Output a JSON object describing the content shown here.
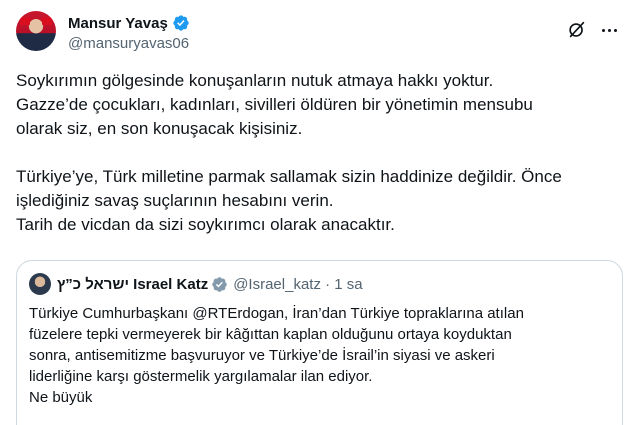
{
  "author": {
    "display_name": "Mansur Yavaş",
    "handle": "@mansuryavas06"
  },
  "tweet": {
    "lines": [
      "Soykırımın gölgesinde konuşanların nutuk atmaya hakkı yoktur.",
      "Gazze’de çocukları, kadınları, sivilleri öldüren bir yönetimin mensubu",
      "olarak siz, en son konuşacak kişisiniz.",
      "Türkiye’ye, Türk milletine parmak sallamak sizin haddinize değildir. Önce",
      "işlediğiniz savaş suçlarının hesabını verin.",
      "Tarih de vicdan da sizi soykırımcı olarak anacaktır."
    ]
  },
  "quoted": {
    "display_name": "ישראל כ”ץ Israel Katz",
    "handle_time": "@Israel_katz · 1 sa",
    "lines": [
      "Türkiye Cumhurbaşkanı @RTErdogan, İran’dan Türkiye topraklarına atılan",
      "füzelere tepki vermeyerek bir kâğıttan kaplan olduğunu ortaya koyduktan",
      "sonra, antisemitizme başvuruyor ve Türkiye’de İsrail’in siyasi ve askeri",
      "liderliğine karşı göstermelik yargılamalar ilan ediyor.",
      "Ne büyük"
    ]
  },
  "icons": {
    "verified": "verified-badge-icon",
    "grok": "grok-icon",
    "more": "more-icon"
  },
  "colors": {
    "verified_blue": "#1d9bf0",
    "secondary_text": "#536471",
    "border": "#cfd9de"
  }
}
